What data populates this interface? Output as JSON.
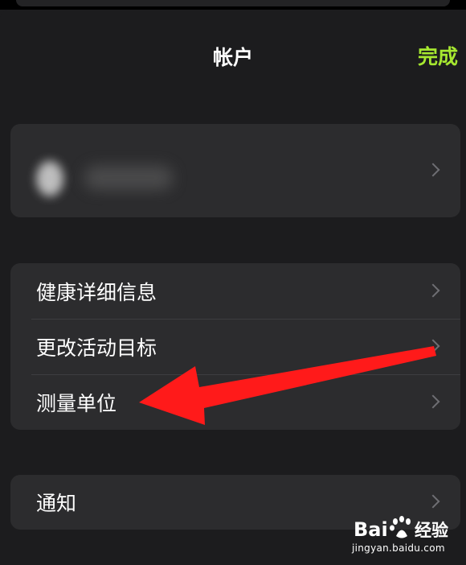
{
  "header": {
    "title": "帐户",
    "done_label": "完成"
  },
  "account": {
    "obscured": true
  },
  "settings": {
    "items": [
      {
        "label": "健康详细信息"
      },
      {
        "label": "更改活动目标"
      },
      {
        "label": "测量单位"
      }
    ]
  },
  "notifications": {
    "label": "通知"
  },
  "annotation": {
    "arrow_color": "#ff1a1a",
    "points_to": "测量单位"
  },
  "watermark": {
    "brand": "Bai  经验",
    "url": "jingyan.baidu.com"
  },
  "colors": {
    "accent": "#a6e830",
    "background": "#1c1c1e",
    "cell": "#2c2c2e",
    "chevron": "#6e6e73"
  }
}
